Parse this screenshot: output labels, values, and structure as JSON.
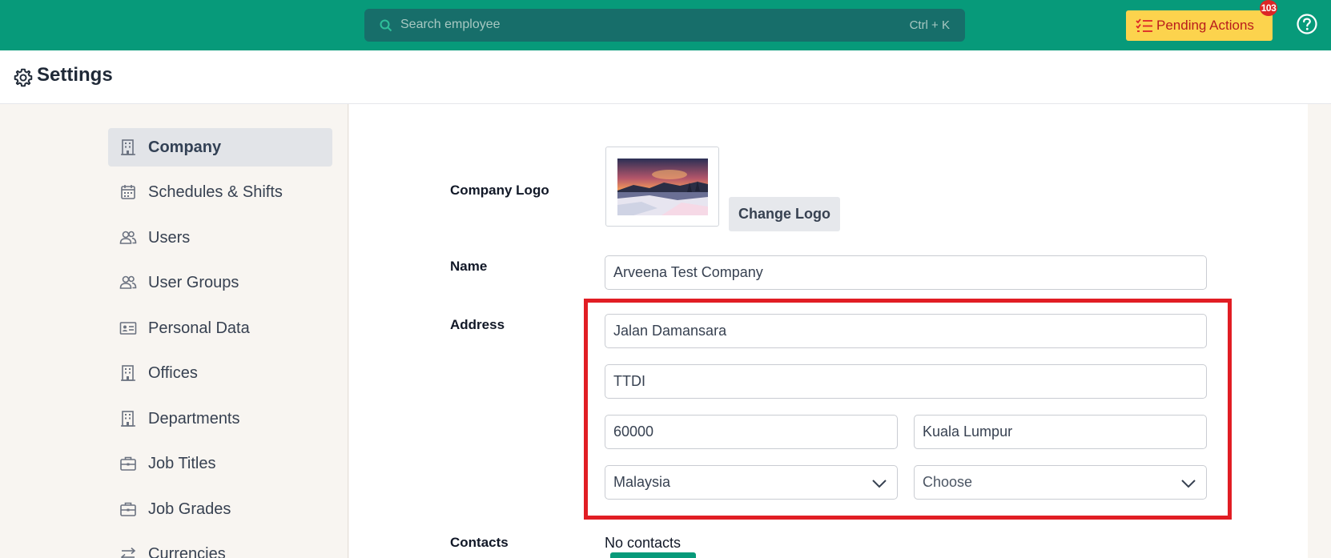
{
  "topbar": {
    "search_placeholder": "Search employee",
    "search_shortcut": "Ctrl + K",
    "pending_label": "Pending Actions",
    "pending_count": "103",
    "accent_color": "#079a7a"
  },
  "page": {
    "title": "Settings"
  },
  "sidebar": {
    "items": [
      {
        "label": "Company",
        "icon": "building-icon",
        "active": true
      },
      {
        "label": "Schedules & Shifts",
        "icon": "calendar-icon",
        "active": false
      },
      {
        "label": "Users",
        "icon": "users-icon",
        "active": false
      },
      {
        "label": "User Groups",
        "icon": "user-groups-icon",
        "active": false
      },
      {
        "label": "Personal Data",
        "icon": "id-card-icon",
        "active": false
      },
      {
        "label": "Offices",
        "icon": "building-icon",
        "active": false
      },
      {
        "label": "Departments",
        "icon": "building-icon",
        "active": false
      },
      {
        "label": "Job Titles",
        "icon": "briefcase-icon",
        "active": false
      },
      {
        "label": "Job Grades",
        "icon": "briefcase-icon",
        "active": false
      },
      {
        "label": "Currencies",
        "icon": "swap-arrows-icon",
        "active": false
      }
    ]
  },
  "form": {
    "logo_label": "Company Logo",
    "change_logo_label": "Change Logo",
    "name_label": "Name",
    "name_value": "Arveena Test Company",
    "address_label": "Address",
    "address_line1": "Jalan Damansara",
    "address_line2": "TTDI",
    "postcode": "60000",
    "city": "Kuala Lumpur",
    "country": "Malaysia",
    "state": "Choose",
    "contacts_label": "Contacts",
    "contacts_empty": "No contacts"
  },
  "highlight_color": "#e11d24"
}
